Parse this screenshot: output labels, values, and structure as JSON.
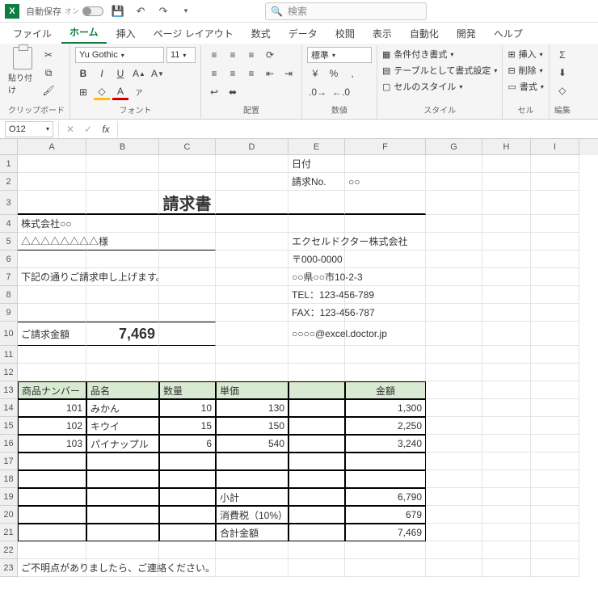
{
  "titlebar": {
    "autosave": "自動保存",
    "autosave_state": "オン",
    "search_placeholder": "検索"
  },
  "tabs": [
    "ファイル",
    "ホーム",
    "挿入",
    "ページ レイアウト",
    "数式",
    "データ",
    "校閲",
    "表示",
    "自動化",
    "開発",
    "ヘルプ"
  ],
  "active_tab": "ホーム",
  "ribbon": {
    "clipboard": {
      "paste": "貼り付け",
      "label": "クリップボード"
    },
    "font": {
      "name": "Yu Gothic",
      "size": "11",
      "bold": "B",
      "italic": "I",
      "underline": "U",
      "label": "フォント"
    },
    "align": {
      "label": "配置"
    },
    "number": {
      "format": "標準",
      "label": "数値"
    },
    "styles": {
      "cond": "条件付き書式",
      "table": "テーブルとして書式設定",
      "cell": "セルのスタイル",
      "label": "スタイル"
    },
    "cells": {
      "insert": "挿入",
      "delete": "削除",
      "format": "書式",
      "label": "セル"
    },
    "editing": {
      "label": "編集"
    }
  },
  "formula_bar": {
    "name_box": "O12",
    "formula": ""
  },
  "columns": [
    "A",
    "B",
    "C",
    "D",
    "E",
    "F",
    "G",
    "H",
    "I"
  ],
  "row_count": 23,
  "invoice": {
    "date_label": "日付",
    "no_label": "請求No.",
    "no_value": "○○",
    "title": "請求書",
    "company": "株式会社○○",
    "attn": "△△△△△△△△様",
    "intro": "下記の通りご請求申し上げます。",
    "amount_label": "ご請求金額",
    "amount_value": "7,469",
    "supplier": {
      "name": "エクセルドクター株式会社",
      "postal": "〒000-0000",
      "addr": "○○県○○市10-2-3",
      "tel": "TEL：123-456-789",
      "fax": "FAX：123-456-787",
      "mail": "○○○○@excel.doctor.jp"
    },
    "table": {
      "headers": [
        "商品ナンバー",
        "品名",
        "数量",
        "単価",
        "",
        "金額"
      ],
      "rows": [
        {
          "no": "101",
          "name": "みかん",
          "qty": "10",
          "price": "130",
          "amount": "1,300"
        },
        {
          "no": "102",
          "name": "キウイ",
          "qty": "15",
          "price": "150",
          "amount": "2,250"
        },
        {
          "no": "103",
          "name": "パイナップル",
          "qty": "6",
          "price": "540",
          "amount": "3,240"
        }
      ],
      "subtotal_label": "小計",
      "subtotal": "6,790",
      "tax_label": "消費税（10%）",
      "tax": "679",
      "total_label": "合計金額",
      "total": "7,469"
    },
    "footer": "ご不明点がありましたら、ご連絡ください。"
  }
}
